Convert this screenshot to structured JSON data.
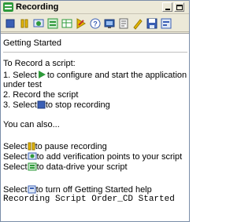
{
  "window": {
    "title": "Recording"
  },
  "toolbar": {
    "buttons": [
      {
        "name": "stop-recording",
        "icon": "stop-icon"
      },
      {
        "name": "pause-recording",
        "icon": "pause-icon"
      },
      {
        "name": "insert-verification-point",
        "icon": "verification-point-icon"
      },
      {
        "name": "insert-data-driven",
        "icon": "data-driven-icon"
      },
      {
        "name": "insert-datapool",
        "icon": "datapool-icon"
      },
      {
        "name": "start-application",
        "icon": "start-application-icon"
      },
      {
        "name": "help",
        "icon": "help-icon"
      },
      {
        "name": "display-monitor",
        "icon": "monitor-icon"
      },
      {
        "name": "insert-script-support",
        "icon": "script-support-icon"
      },
      {
        "name": "comment",
        "icon": "comment-icon"
      },
      {
        "name": "save",
        "icon": "save-icon"
      },
      {
        "name": "getting-started",
        "icon": "getting-started-icon"
      }
    ]
  },
  "content": {
    "heading": "Getting Started",
    "intro": "To Record a script:",
    "step1_a": "1. Select",
    "step1_b": "to configure and start the application",
    "step1_c": "under test",
    "step2": "2. Record the script",
    "step3_a": "3. Select",
    "step3_b": "to stop recording",
    "also": "You can also...",
    "pause_a": "Select",
    "pause_b": "to pause recording",
    "vp_a": "Select",
    "vp_b": "to add verification points to your script",
    "dd_a": "Select",
    "dd_b": "to data-drive your script",
    "gs_a": "Select",
    "gs_b": "to turn off Getting Started help",
    "log_line": "Recording Script Order_CD Started"
  },
  "colors": {
    "window_bg": "#ece9d8",
    "content_bg": "#ffffff",
    "accent_blue": "#2d5fa8",
    "accent_green": "#2e9a3a",
    "accent_yellow": "#e6b800"
  }
}
